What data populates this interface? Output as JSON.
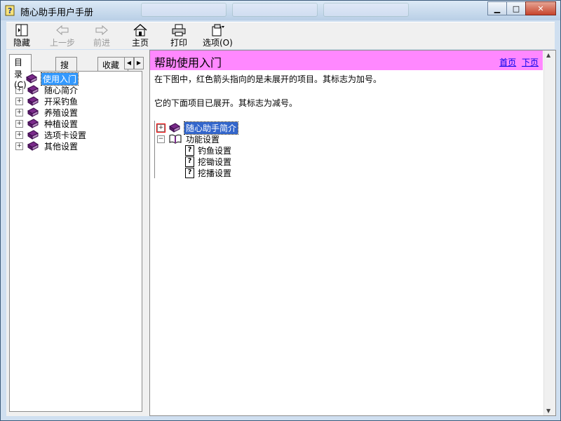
{
  "window": {
    "title": "随心助手用户手册"
  },
  "toolbar": {
    "hide": "隐藏",
    "back": "上一步",
    "forward": "前进",
    "home": "主页",
    "print": "打印",
    "options": "选项(O)"
  },
  "nav_tabs": {
    "contents": "目录(C)",
    "search": "搜索(S)",
    "favorites": "收藏"
  },
  "tree": {
    "items": [
      {
        "label": "使用入门",
        "selected": true,
        "expandable": false
      },
      {
        "label": "随心简介",
        "expandable": true
      },
      {
        "label": "开采钓鱼",
        "expandable": true
      },
      {
        "label": "养殖设置",
        "expandable": true
      },
      {
        "label": "种植设置",
        "expandable": true
      },
      {
        "label": "选项卡设置",
        "expandable": true
      },
      {
        "label": "其他设置",
        "expandable": true
      }
    ]
  },
  "content": {
    "heading": "帮助使用入门",
    "link_home": "首页",
    "link_next": "下页",
    "para1": "在下图中，红色箭头指向的是未展开的项目。其标志为加号。",
    "para2": "它的下面项目已展开。其标志为减号。",
    "demo": {
      "collapsed": "随心助手简介",
      "expanded": "功能设置",
      "children": [
        "钓鱼设置",
        "挖锄设置",
        "挖播设置"
      ]
    }
  },
  "colors": {
    "header_bg": "#ff88ff",
    "link": "#0000ee",
    "selection": "#3399ff",
    "book": "#7a2a8a"
  }
}
